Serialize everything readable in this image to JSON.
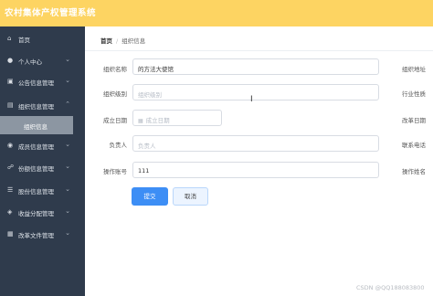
{
  "app": {
    "title": "农村集体产权管理系统"
  },
  "sidebar": {
    "items": [
      {
        "label": "首页",
        "icon": "home-icon",
        "expandable": false
      },
      {
        "label": "个人中心",
        "icon": "user-icon",
        "expandable": true
      },
      {
        "label": "公告信息管理",
        "icon": "notice-icon",
        "expandable": true
      },
      {
        "label": "组织信息管理",
        "icon": "org-icon",
        "expandable": true
      },
      {
        "label": "成员信息管理",
        "icon": "members-icon",
        "expandable": true
      },
      {
        "label": "份额信息管理",
        "icon": "share-icon",
        "expandable": true
      },
      {
        "label": "股份信息管理",
        "icon": "stock-icon",
        "expandable": true
      },
      {
        "label": "收益分配管理",
        "icon": "income-icon",
        "expandable": true
      },
      {
        "label": "改革文件管理",
        "icon": "file-icon",
        "expandable": true
      }
    ],
    "submenu": {
      "label": "组织信息",
      "active": true
    }
  },
  "breadcrumb": {
    "home": "首页",
    "separator": "/",
    "current": "组织信息"
  },
  "form": {
    "org_name": {
      "label": "组织名称",
      "value": "的方法大使馆"
    },
    "org_level": {
      "label": "组织级别",
      "placeholder": "组织级别"
    },
    "founded_date": {
      "label": "成立日期",
      "placeholder": "成立日期"
    },
    "manager": {
      "label": "负责人",
      "placeholder": "负责人"
    },
    "operator_account": {
      "label": "操作账号",
      "value": "111"
    },
    "right_labels": [
      "组织地址",
      "行业性质",
      "改革日期",
      "联系电话",
      "操作姓名"
    ],
    "submit_label": "提交",
    "cancel_label": "取消"
  },
  "watermark": "CSDN @QQ188083800",
  "colors": {
    "topbar": "#fdd462",
    "sidebar": "#2f3b4c",
    "submit": "#3d8ef5"
  }
}
